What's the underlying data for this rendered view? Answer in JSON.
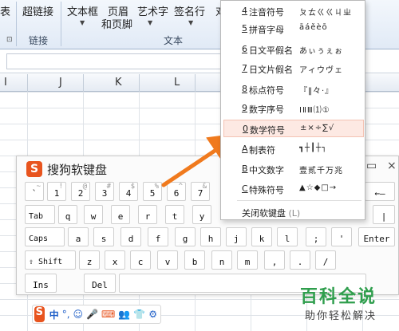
{
  "ribbon": {
    "items": [
      "表",
      "超链接",
      "文本框",
      "页眉",
      "和页脚",
      "艺术字",
      "签名行",
      "对"
    ],
    "groups": [
      "链接",
      "文本"
    ]
  },
  "columns": [
    "I",
    "J",
    "K",
    "L"
  ],
  "keyboard": {
    "title": "搜狗软键盘",
    "controls": [
      "▭",
      "×"
    ],
    "row1": [
      {
        "main": "`",
        "top": "~"
      },
      {
        "main": "1",
        "top": "!"
      },
      {
        "main": "2",
        "top": "@"
      },
      {
        "main": "3",
        "top": "#"
      },
      {
        "main": "4",
        "top": "$"
      },
      {
        "main": "5",
        "top": "%"
      },
      {
        "main": "6",
        "top": "^"
      },
      {
        "main": "7",
        "top": "&"
      }
    ],
    "backspace": "←—",
    "row2": [
      "Tab",
      "q",
      "w",
      "e",
      "r",
      "t",
      "y"
    ],
    "row2_tail": "|",
    "row3": [
      "Caps",
      "a",
      "s",
      "d",
      "f",
      "g",
      "h",
      "j",
      "k",
      "l"
    ],
    "row3_extra": [
      ";",
      "'"
    ],
    "enter": "Enter",
    "row4": [
      "⇧ Shift",
      "z",
      "x",
      "c",
      "v",
      "b",
      "n",
      "m",
      ",",
      "."
    ],
    "row4_extra": "/",
    "row5": [
      "Ins",
      "Del"
    ]
  },
  "menu": {
    "items": [
      {
        "key": "4",
        "label": "注音符号",
        "sample": "ㄆㄊㄍㄍㄐㄓ"
      },
      {
        "key": "5",
        "label": "拼音字母",
        "sample": "āáěèō"
      },
      {
        "key": "6",
        "label": "日文平假名",
        "sample": "あぃぅぇぉ"
      },
      {
        "key": "7",
        "label": "日文片假名",
        "sample": "アィウヴェ"
      },
      {
        "key": "8",
        "label": "标点符号",
        "sample": "『‖々·』"
      },
      {
        "key": "9",
        "label": "数字序号",
        "sample": "ⅠⅡⅢ⑴①"
      },
      {
        "key": "0",
        "label": "数学符号",
        "sample": "±×÷∑√"
      },
      {
        "key": "A",
        "label": "制表符",
        "sample": "┓┼┃┼┐"
      },
      {
        "key": "B",
        "label": "中文数字",
        "sample": "壹贰千万兆"
      },
      {
        "key": "C",
        "label": "特殊符号",
        "sample": "▲☆◆□→"
      }
    ],
    "close_label": "关闭软键盘",
    "close_shortcut": "(L)",
    "highlight_color": "#fde9e3"
  },
  "ime_bar": {
    "logo": "S",
    "items": [
      "中",
      "°,",
      "☺",
      "🎤",
      "⌨",
      "👥",
      "👕",
      "⚙"
    ]
  },
  "watermark": {
    "title": "百科全说",
    "subtitle": "助你轻松解决"
  },
  "colors": {
    "arrow": "#f07a1e",
    "sogou_brand": "#e8541e",
    "watermark_green": "#2f9e4d"
  }
}
